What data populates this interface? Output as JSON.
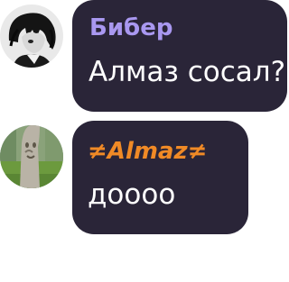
{
  "messages": [
    {
      "sender": "Бибер",
      "text": "Алмаз сосал?",
      "sender_color": "#a998f0",
      "avatar_icon": "anime-avatar-icon"
    },
    {
      "sender": "≠Almaz≠",
      "text": "доооо",
      "sender_color": "#f08a26",
      "avatar_icon": "tree-avatar-icon"
    }
  ],
  "colors": {
    "bubble_background": "#2a2538",
    "message_text": "#ffffff",
    "page_background": "#ffffff"
  }
}
